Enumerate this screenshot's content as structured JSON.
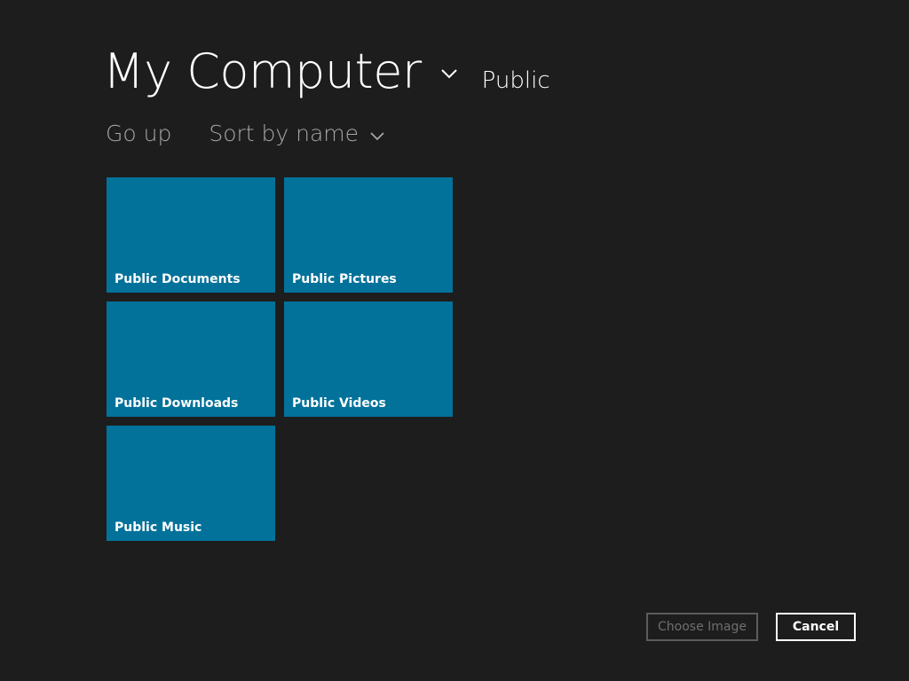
{
  "header": {
    "location": "My Computer",
    "sub_location": "Public"
  },
  "commands": {
    "go_up": "Go up",
    "sort": "Sort by name"
  },
  "tiles": [
    {
      "label": "Public Documents"
    },
    {
      "label": "Public Pictures"
    },
    {
      "label": "Public Downloads"
    },
    {
      "label": "Public Videos"
    },
    {
      "label": "Public Music"
    }
  ],
  "buttons": {
    "choose": "Choose Image",
    "cancel": "Cancel"
  },
  "colors": {
    "background": "#1d1d1d",
    "tile": "#03729a",
    "muted_text": "#a6a6a6",
    "disabled_border": "#5c5c5c"
  },
  "icons": {
    "location_dropdown": "chevron-down-icon",
    "sort_dropdown": "chevron-down-icon"
  }
}
